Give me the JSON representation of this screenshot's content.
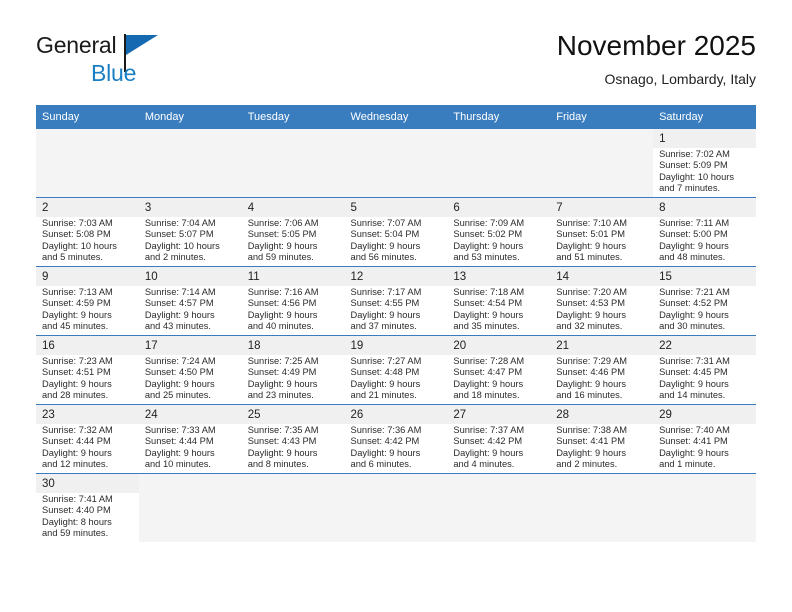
{
  "brand": {
    "name_part1": "General",
    "name_part2": "Blue",
    "flag_color": "#1469b0",
    "blue_color": "#1b7fc4"
  },
  "header": {
    "title": "November 2025",
    "subtitle": "Osnago, Lombardy, Italy"
  },
  "calendar": {
    "header_bg": "#3a7dbf",
    "weekdays": [
      "Sunday",
      "Monday",
      "Tuesday",
      "Wednesday",
      "Thursday",
      "Friday",
      "Saturday"
    ],
    "weeks": [
      [
        {
          "day": "",
          "sunrise": "",
          "sunset": "",
          "daylight": "",
          "daylight2": ""
        },
        {
          "day": "",
          "sunrise": "",
          "sunset": "",
          "daylight": "",
          "daylight2": ""
        },
        {
          "day": "",
          "sunrise": "",
          "sunset": "",
          "daylight": "",
          "daylight2": ""
        },
        {
          "day": "",
          "sunrise": "",
          "sunset": "",
          "daylight": "",
          "daylight2": ""
        },
        {
          "day": "",
          "sunrise": "",
          "sunset": "",
          "daylight": "",
          "daylight2": ""
        },
        {
          "day": "",
          "sunrise": "",
          "sunset": "",
          "daylight": "",
          "daylight2": ""
        },
        {
          "day": "1",
          "sunrise": "Sunrise: 7:02 AM",
          "sunset": "Sunset: 5:09 PM",
          "daylight": "Daylight: 10 hours",
          "daylight2": "and 7 minutes."
        }
      ],
      [
        {
          "day": "2",
          "sunrise": "Sunrise: 7:03 AM",
          "sunset": "Sunset: 5:08 PM",
          "daylight": "Daylight: 10 hours",
          "daylight2": "and 5 minutes."
        },
        {
          "day": "3",
          "sunrise": "Sunrise: 7:04 AM",
          "sunset": "Sunset: 5:07 PM",
          "daylight": "Daylight: 10 hours",
          "daylight2": "and 2 minutes."
        },
        {
          "day": "4",
          "sunrise": "Sunrise: 7:06 AM",
          "sunset": "Sunset: 5:05 PM",
          "daylight": "Daylight: 9 hours",
          "daylight2": "and 59 minutes."
        },
        {
          "day": "5",
          "sunrise": "Sunrise: 7:07 AM",
          "sunset": "Sunset: 5:04 PM",
          "daylight": "Daylight: 9 hours",
          "daylight2": "and 56 minutes."
        },
        {
          "day": "6",
          "sunrise": "Sunrise: 7:09 AM",
          "sunset": "Sunset: 5:02 PM",
          "daylight": "Daylight: 9 hours",
          "daylight2": "and 53 minutes."
        },
        {
          "day": "7",
          "sunrise": "Sunrise: 7:10 AM",
          "sunset": "Sunset: 5:01 PM",
          "daylight": "Daylight: 9 hours",
          "daylight2": "and 51 minutes."
        },
        {
          "day": "8",
          "sunrise": "Sunrise: 7:11 AM",
          "sunset": "Sunset: 5:00 PM",
          "daylight": "Daylight: 9 hours",
          "daylight2": "and 48 minutes."
        }
      ],
      [
        {
          "day": "9",
          "sunrise": "Sunrise: 7:13 AM",
          "sunset": "Sunset: 4:59 PM",
          "daylight": "Daylight: 9 hours",
          "daylight2": "and 45 minutes."
        },
        {
          "day": "10",
          "sunrise": "Sunrise: 7:14 AM",
          "sunset": "Sunset: 4:57 PM",
          "daylight": "Daylight: 9 hours",
          "daylight2": "and 43 minutes."
        },
        {
          "day": "11",
          "sunrise": "Sunrise: 7:16 AM",
          "sunset": "Sunset: 4:56 PM",
          "daylight": "Daylight: 9 hours",
          "daylight2": "and 40 minutes."
        },
        {
          "day": "12",
          "sunrise": "Sunrise: 7:17 AM",
          "sunset": "Sunset: 4:55 PM",
          "daylight": "Daylight: 9 hours",
          "daylight2": "and 37 minutes."
        },
        {
          "day": "13",
          "sunrise": "Sunrise: 7:18 AM",
          "sunset": "Sunset: 4:54 PM",
          "daylight": "Daylight: 9 hours",
          "daylight2": "and 35 minutes."
        },
        {
          "day": "14",
          "sunrise": "Sunrise: 7:20 AM",
          "sunset": "Sunset: 4:53 PM",
          "daylight": "Daylight: 9 hours",
          "daylight2": "and 32 minutes."
        },
        {
          "day": "15",
          "sunrise": "Sunrise: 7:21 AM",
          "sunset": "Sunset: 4:52 PM",
          "daylight": "Daylight: 9 hours",
          "daylight2": "and 30 minutes."
        }
      ],
      [
        {
          "day": "16",
          "sunrise": "Sunrise: 7:23 AM",
          "sunset": "Sunset: 4:51 PM",
          "daylight": "Daylight: 9 hours",
          "daylight2": "and 28 minutes."
        },
        {
          "day": "17",
          "sunrise": "Sunrise: 7:24 AM",
          "sunset": "Sunset: 4:50 PM",
          "daylight": "Daylight: 9 hours",
          "daylight2": "and 25 minutes."
        },
        {
          "day": "18",
          "sunrise": "Sunrise: 7:25 AM",
          "sunset": "Sunset: 4:49 PM",
          "daylight": "Daylight: 9 hours",
          "daylight2": "and 23 minutes."
        },
        {
          "day": "19",
          "sunrise": "Sunrise: 7:27 AM",
          "sunset": "Sunset: 4:48 PM",
          "daylight": "Daylight: 9 hours",
          "daylight2": "and 21 minutes."
        },
        {
          "day": "20",
          "sunrise": "Sunrise: 7:28 AM",
          "sunset": "Sunset: 4:47 PM",
          "daylight": "Daylight: 9 hours",
          "daylight2": "and 18 minutes."
        },
        {
          "day": "21",
          "sunrise": "Sunrise: 7:29 AM",
          "sunset": "Sunset: 4:46 PM",
          "daylight": "Daylight: 9 hours",
          "daylight2": "and 16 minutes."
        },
        {
          "day": "22",
          "sunrise": "Sunrise: 7:31 AM",
          "sunset": "Sunset: 4:45 PM",
          "daylight": "Daylight: 9 hours",
          "daylight2": "and 14 minutes."
        }
      ],
      [
        {
          "day": "23",
          "sunrise": "Sunrise: 7:32 AM",
          "sunset": "Sunset: 4:44 PM",
          "daylight": "Daylight: 9 hours",
          "daylight2": "and 12 minutes."
        },
        {
          "day": "24",
          "sunrise": "Sunrise: 7:33 AM",
          "sunset": "Sunset: 4:44 PM",
          "daylight": "Daylight: 9 hours",
          "daylight2": "and 10 minutes."
        },
        {
          "day": "25",
          "sunrise": "Sunrise: 7:35 AM",
          "sunset": "Sunset: 4:43 PM",
          "daylight": "Daylight: 9 hours",
          "daylight2": "and 8 minutes."
        },
        {
          "day": "26",
          "sunrise": "Sunrise: 7:36 AM",
          "sunset": "Sunset: 4:42 PM",
          "daylight": "Daylight: 9 hours",
          "daylight2": "and 6 minutes."
        },
        {
          "day": "27",
          "sunrise": "Sunrise: 7:37 AM",
          "sunset": "Sunset: 4:42 PM",
          "daylight": "Daylight: 9 hours",
          "daylight2": "and 4 minutes."
        },
        {
          "day": "28",
          "sunrise": "Sunrise: 7:38 AM",
          "sunset": "Sunset: 4:41 PM",
          "daylight": "Daylight: 9 hours",
          "daylight2": "and 2 minutes."
        },
        {
          "day": "29",
          "sunrise": "Sunrise: 7:40 AM",
          "sunset": "Sunset: 4:41 PM",
          "daylight": "Daylight: 9 hours",
          "daylight2": "and 1 minute."
        }
      ],
      [
        {
          "day": "30",
          "sunrise": "Sunrise: 7:41 AM",
          "sunset": "Sunset: 4:40 PM",
          "daylight": "Daylight: 8 hours",
          "daylight2": "and 59 minutes."
        },
        {
          "day": "",
          "sunrise": "",
          "sunset": "",
          "daylight": "",
          "daylight2": ""
        },
        {
          "day": "",
          "sunrise": "",
          "sunset": "",
          "daylight": "",
          "daylight2": ""
        },
        {
          "day": "",
          "sunrise": "",
          "sunset": "",
          "daylight": "",
          "daylight2": ""
        },
        {
          "day": "",
          "sunrise": "",
          "sunset": "",
          "daylight": "",
          "daylight2": ""
        },
        {
          "day": "",
          "sunrise": "",
          "sunset": "",
          "daylight": "",
          "daylight2": ""
        },
        {
          "day": "",
          "sunrise": "",
          "sunset": "",
          "daylight": "",
          "daylight2": ""
        }
      ]
    ]
  }
}
